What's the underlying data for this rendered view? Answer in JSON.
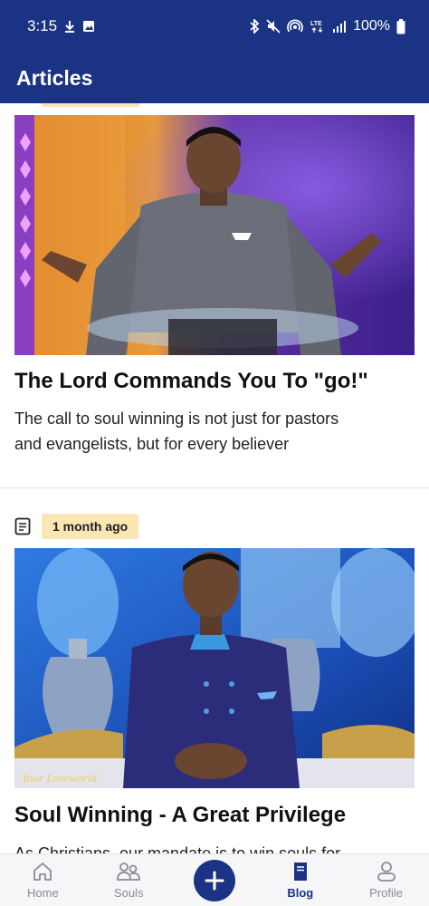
{
  "status_bar": {
    "time": "3:15",
    "battery": "100%",
    "left_icons": [
      "download-icon",
      "image-icon"
    ],
    "right_icons": [
      "bluetooth-icon",
      "mute-icon",
      "hotspot-icon",
      "lte-icon",
      "signal-icon",
      "battery-icon"
    ]
  },
  "app_bar": {
    "title": "Articles"
  },
  "articles": [
    {
      "title": "The Lord Commands You To \"go!\"",
      "summary_line1": "The call to soul winning is not just for pastors",
      "summary_line2": "and evangelists, but for every believer"
    },
    {
      "time_ago": "1 month ago",
      "title": "Soul Winning - A Great Privilege",
      "summary_line1": "As Christians, our mandate is to win souls for",
      "image_caption": "Your Loveworld"
    }
  ],
  "bottom_nav": {
    "items": [
      {
        "label": "Home",
        "icon": "home-icon"
      },
      {
        "label": "Souls",
        "icon": "people-icon"
      },
      {
        "label": "",
        "icon": "plus-icon"
      },
      {
        "label": "Blog",
        "icon": "book-icon"
      },
      {
        "label": "Profile",
        "icon": "person-icon"
      }
    ],
    "active": "Blog"
  },
  "colors": {
    "primary": "#1b3384",
    "badge": "#fbe7b3",
    "inactive": "#888c94"
  }
}
